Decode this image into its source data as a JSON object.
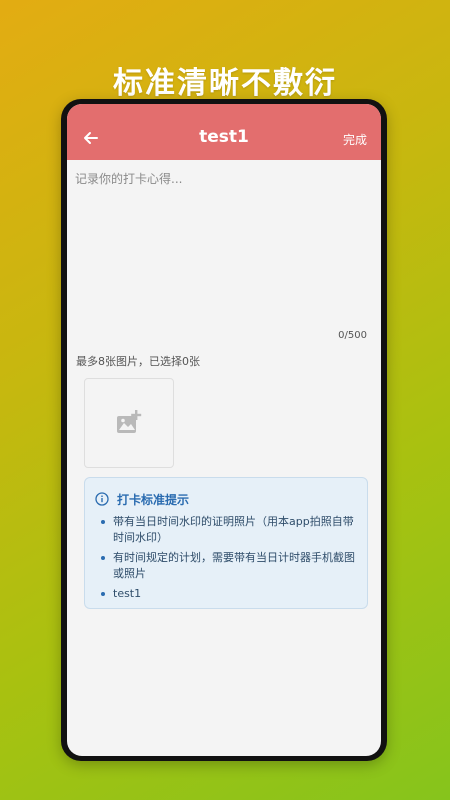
{
  "promo": {
    "headline": "标准清晰不敷衍"
  },
  "appbar": {
    "title": "test1",
    "done_label": "完成",
    "back_icon": "arrow-left-icon"
  },
  "note": {
    "placeholder": "记录你的打卡心得...",
    "value": "",
    "counter": "0/500"
  },
  "photos": {
    "hint": "最多8张图片，已选择0张",
    "add_icon": "add-photo-icon"
  },
  "tips": {
    "title": "打卡标准提示",
    "icon": "info-icon",
    "items": [
      "带有当日时间水印的证明照片（用本app拍照自带时间水印）",
      "有时间规定的计划，需要带有当日计时器手机截图或照片",
      "test1"
    ]
  },
  "colors": {
    "appbar": "#e36e6e",
    "tips_bg": "#e6f0f8",
    "tips_accent": "#2b6cb0",
    "background_start": "#e3ac12",
    "background_end": "#86c41c"
  }
}
